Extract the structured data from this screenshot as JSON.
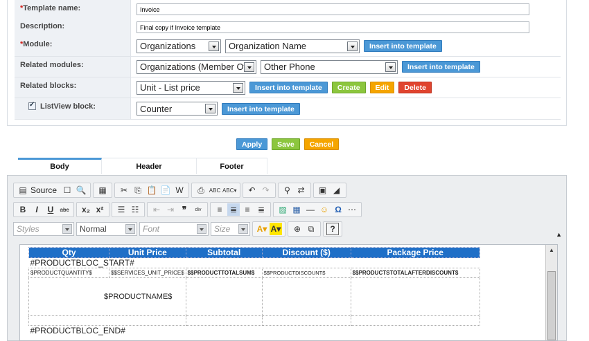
{
  "form": {
    "template_name": {
      "label": "Template name:",
      "value": "Invoice"
    },
    "description": {
      "label": "Description:",
      "value": "Final copy if Invoice template"
    },
    "module": {
      "label": "Module:",
      "select1": "Organizations",
      "select2": "Organization Name",
      "insert": "Insert into template"
    },
    "related_modules": {
      "label": "Related modules:",
      "select1": "Organizations (Member Of)",
      "select2": "Other Phone",
      "insert": "Insert into template"
    },
    "related_blocks": {
      "label": "Related blocks:",
      "select1": "Unit - List price",
      "insert": "Insert into template",
      "create": "Create",
      "edit": "Edit",
      "delete": "Delete"
    },
    "listview_block": {
      "label": "ListView block:",
      "checked": true,
      "select1": "Counter",
      "insert": "Insert into template"
    },
    "required_mark": "*"
  },
  "actions": {
    "apply": "Apply",
    "save": "Save",
    "cancel": "Cancel"
  },
  "tabs": [
    {
      "label": "Body",
      "active": true
    },
    {
      "label": "Header"
    },
    {
      "label": "Footer"
    }
  ],
  "toolbar": {
    "source": "Source",
    "styles": "Styles",
    "format": "Normal",
    "font": "Font",
    "size": "Size"
  },
  "editor_content": {
    "headers": [
      "Qty",
      "Unit Price",
      "Subtotal",
      "Discount ($)",
      "Package Price"
    ],
    "start_marker": "#PRODUCTBLOC_START#",
    "row": [
      "$PRODUCTQUANTITY$",
      "$$SERVICES_UNIT_PRICE$",
      "$$PRODUCTTOTALSUM$",
      "$$PRODUCTDISCOUNT$",
      "$$PRODUCTSTOTALAFTERDISCOUNT$"
    ],
    "product_name": "$PRODUCTNAME$",
    "end_marker": "#PRODUCTBLOC_END#"
  },
  "colors": {
    "blue": "#4b98d6",
    "green": "#8cc63e",
    "orange": "#f5a500",
    "red": "#e0442f",
    "header_blue": "#1f6fc7"
  }
}
